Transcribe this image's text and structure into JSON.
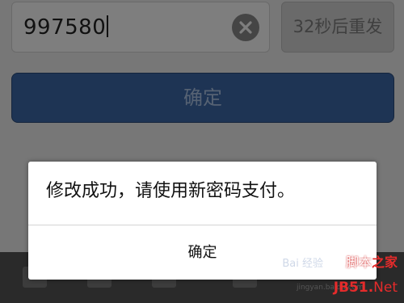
{
  "form": {
    "code_value": "997580",
    "resend_label": "32秒后重发",
    "confirm_label": "确定"
  },
  "dialog": {
    "message": "修改成功，请使用新密码支付。",
    "ok_label": "确定"
  },
  "watermark": {
    "baidu": "Bai 经验",
    "top_prefix": "脚本",
    "top_brand": "之家",
    "site": "jingyan.baidu.com",
    "jb": "JB51.",
    "net": "Net"
  },
  "colors": {
    "overlay": "#777777",
    "confirm_button": "#1e3454",
    "dialog_bg": "#ffffff",
    "watermark_red": "#e52b2b"
  }
}
